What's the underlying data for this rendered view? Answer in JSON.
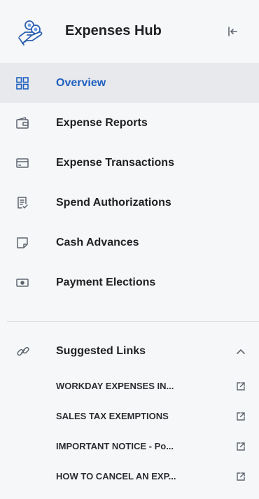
{
  "header": {
    "title": "Expenses Hub",
    "logo_icon": "hand-coins-icon",
    "collapse_icon": "collapse-left-icon"
  },
  "nav": {
    "active_color": "#1f5fbf",
    "items": [
      {
        "label": "Overview",
        "icon": "dashboard-grid-icon",
        "active": true
      },
      {
        "label": "Expense Reports",
        "icon": "wallet-icon",
        "active": false
      },
      {
        "label": "Expense Transactions",
        "icon": "credit-card-icon",
        "active": false
      },
      {
        "label": "Spend Authorizations",
        "icon": "document-check-icon",
        "active": false
      },
      {
        "label": "Cash Advances",
        "icon": "note-icon",
        "active": false
      },
      {
        "label": "Payment Elections",
        "icon": "cash-icon",
        "active": false
      }
    ]
  },
  "suggested": {
    "label": "Suggested Links",
    "icon": "link-icon",
    "chevron_icon": "chevron-up-icon",
    "links": [
      {
        "label": "WORKDAY EXPENSES IN...",
        "icon": "external-link-icon"
      },
      {
        "label": "SALES TAX EXEMPTIONS",
        "icon": "external-link-icon"
      },
      {
        "label": "IMPORTANT NOTICE - Po...",
        "icon": "external-link-icon"
      },
      {
        "label": "HOW TO CANCEL AN EXP...",
        "icon": "external-link-icon"
      }
    ]
  }
}
